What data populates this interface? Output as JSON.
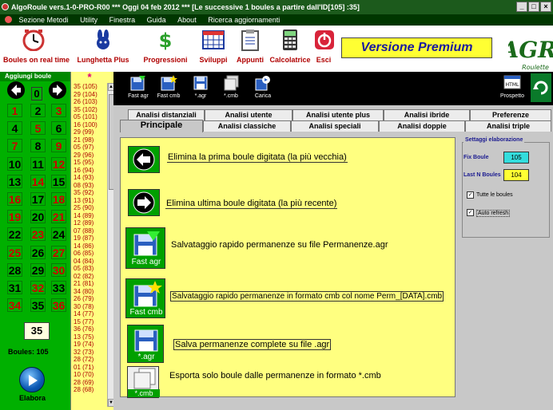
{
  "title": {
    "app": "AlgoRoule vers.1-0-PRO-R00",
    "date": "Oggi 04 feb 2012",
    "info": "[Le successive 1 boules a partire dall'ID[105] :35]",
    "sep": "***"
  },
  "menu": [
    "Sezione Metodi",
    "Utility",
    "Finestra",
    "Guida",
    "About",
    "Ricerca aggiornamenti"
  ],
  "toolbar": {
    "items": [
      {
        "label": "Boules on real time",
        "icon": "clock-icon"
      },
      {
        "label": "Lunghetta Plus",
        "icon": "rabbit-logo-icon"
      },
      {
        "label": "Progressioni",
        "icon": "dollar-icon"
      },
      {
        "label": "Sviluppi",
        "icon": "calendar-grid-icon"
      },
      {
        "label": "Appunti",
        "icon": "clipboard-icon"
      },
      {
        "label": "Calcolatrice",
        "icon": "calculator-icon"
      },
      {
        "label": "Esci",
        "icon": "power-icon"
      }
    ],
    "premium": "Versione Premium",
    "logo_main": "AGR",
    "logo_sub": "Roulette"
  },
  "left": {
    "header": "Aggiungi boule",
    "zero": "0",
    "last": "35",
    "boules_label": "Boules: 105",
    "elabora": "Elabora"
  },
  "list": {
    "header": "*",
    "items": [
      "35 (105)",
      "29 (104)",
      "26 (103)",
      "35 (102)",
      "05 (101)",
      "16 (100)",
      "29 (99)",
      "21 (98)",
      "05 (97)",
      "29 (96)",
      "15 (95)",
      "16 (94)",
      "14 (93)",
      "08 (93)",
      "35 (92)",
      "13 (91)",
      "25 (90)",
      "14 (89)",
      "12 (89)",
      "07 (88)",
      "19 (87)",
      "14 (86)",
      "06 (85)",
      "04 (84)",
      "05 (83)",
      "02 (82)",
      "21 (81)",
      "34 (80)",
      "26 (79)",
      "30 (78)",
      "14 (77)",
      "15 (77)",
      "36 (76)",
      "13 (75)",
      "19 (74)",
      "32 (73)",
      "28 (72)",
      "01 (71)",
      "10 (70)",
      "28 (69)",
      "28 (68)"
    ]
  },
  "smallbar": [
    {
      "label": "Fast agr",
      "icon": "floppy-green-icon"
    },
    {
      "label": "Fast cmb",
      "icon": "floppy-star-icon"
    },
    {
      "label": "*.agr",
      "icon": "floppy-icon"
    },
    {
      "label": "*.cmb",
      "icon": "floppy-stack-icon"
    },
    {
      "label": "Carica",
      "icon": "load-icon"
    },
    {
      "label": "Prospetto",
      "icon": "html-icon"
    }
  ],
  "tabs": {
    "row1": [
      "Analisi distanziali",
      "Analisi utente",
      "Analisi utente plus",
      "Analisi ibride",
      "Preferenze"
    ],
    "row2": [
      "Principale",
      "Analisi classiche",
      "Analisi speciali",
      "Analisi doppie",
      "Analisi triple"
    ]
  },
  "actions": [
    {
      "text": "Elimina la prima boule digitata (la più vecchia)",
      "icon": "arrow-left-icon"
    },
    {
      "text": "Elimina ultima boule digitata (la più recente)",
      "icon": "arrow-right-icon"
    },
    {
      "text": "Salvataggio rapido permanenze su file Permanenze.agr",
      "label": "Fast agr",
      "icon": "floppy-green-icon"
    },
    {
      "text": "Salvataggio rapido permanenze in formato cmb col nome Perm_[DATA].cmb",
      "label": "Fast cmb",
      "icon": "floppy-star-icon"
    },
    {
      "text": "Salva permanenze complete su file .agr",
      "label": "*.agr",
      "icon": "floppy-icon"
    },
    {
      "text": "Esporta solo boule dalle permanenze in formato *.cmb",
      "label": "*.cmb",
      "icon": "floppy-stack-icon"
    }
  ],
  "settings": {
    "header": "Settaggi elaborazione",
    "fix_label": "Fix Boule",
    "fix_value": "105",
    "lastn_label": "Last N Boules",
    "lastn_value": "104",
    "tutte": "Tutte le boules",
    "auto": "Auto refresh",
    "check": "✓"
  },
  "colors": {
    "green": "#00b000",
    "red": "#cc0000",
    "yellow": "#ffff80"
  }
}
